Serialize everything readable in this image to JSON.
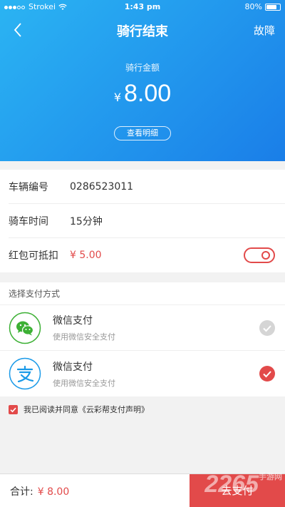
{
  "status_bar": {
    "carrier": "Strokei",
    "time": "1:43 pm",
    "battery": "80%"
  },
  "nav": {
    "title": "骑行结束",
    "fault": "故障"
  },
  "summary": {
    "amount_label": "骑行金额",
    "currency": "¥",
    "amount": "8.00",
    "detail_button": "查看明细"
  },
  "info": {
    "rows": [
      {
        "label": "车辆编号",
        "value": "0286523011"
      },
      {
        "label": "骑车时间",
        "value": "15分钟"
      },
      {
        "label": "红包可抵扣",
        "value": "¥ 5.00"
      }
    ],
    "redpacket_toggle_on": true
  },
  "payment": {
    "title": "选择支付方式",
    "methods": [
      {
        "name": "微信支付",
        "desc": "使用微信安全支付",
        "icon": "wechat-icon",
        "selected": false
      },
      {
        "name": "微信支付",
        "desc": "使用微信安全支付",
        "icon": "alipay-icon",
        "selected": true
      }
    ]
  },
  "agreement": {
    "text": "我已阅读并同意《云彩帮支付声明》",
    "checked": true
  },
  "footer": {
    "total_label": "合计:",
    "total_amount": "¥ 8.00",
    "pay_button": "去支付"
  },
  "watermark": {
    "text": "2265",
    "sub": "手游网"
  },
  "colors": {
    "header_start": "#2bb4f3",
    "header_end": "#1a7ee8",
    "accent": "#e24a4a",
    "wechat": "#3cb034",
    "alipay": "#1a9ae8"
  }
}
